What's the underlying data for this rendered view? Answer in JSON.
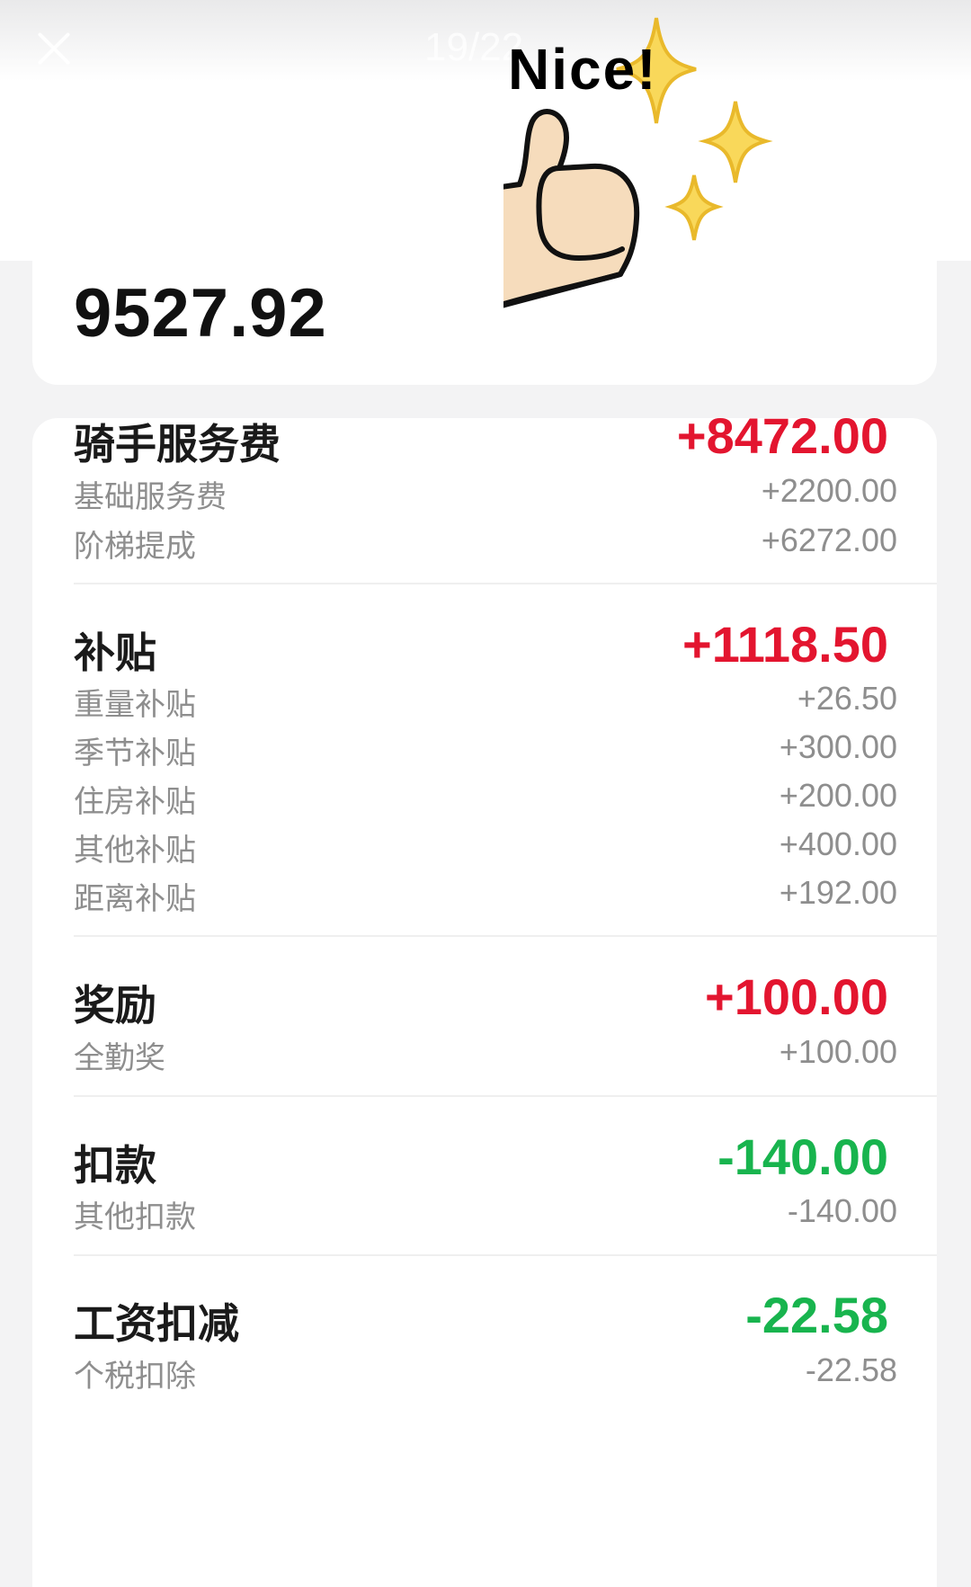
{
  "header": {
    "page_counter": "19/22"
  },
  "sticker": {
    "text": "Nice!",
    "icon": "thumbs-up-sparkles"
  },
  "summary": {
    "total": "9527.92"
  },
  "sections": [
    {
      "title": "骑手服务费",
      "amount": "+8472.00",
      "sign": "positive",
      "items": [
        {
          "label": "基础服务费",
          "value": "+2200.00"
        },
        {
          "label": "阶梯提成",
          "value": "+6272.00"
        }
      ]
    },
    {
      "title": "补贴",
      "amount": "+1118.50",
      "sign": "positive",
      "items": [
        {
          "label": "重量补贴",
          "value": "+26.50"
        },
        {
          "label": "季节补贴",
          "value": "+300.00"
        },
        {
          "label": "住房补贴",
          "value": "+200.00"
        },
        {
          "label": "其他补贴",
          "value": "+400.00"
        },
        {
          "label": "距离补贴",
          "value": "+192.00"
        }
      ]
    },
    {
      "title": "奖励",
      "amount": "+100.00",
      "sign": "positive",
      "items": [
        {
          "label": "全勤奖",
          "value": "+100.00"
        }
      ]
    },
    {
      "title": "扣款",
      "amount": "-140.00",
      "sign": "negative",
      "items": [
        {
          "label": "其他扣款",
          "value": "-140.00"
        }
      ]
    },
    {
      "title": "工资扣减",
      "amount": "-22.58",
      "sign": "negative",
      "items": [
        {
          "label": "个税扣除",
          "value": "-22.58"
        }
      ]
    }
  ],
  "colors": {
    "positive": "#e3152f",
    "negative": "#18b44e",
    "muted": "#8e8e8e",
    "background": "#f3f3f4"
  }
}
